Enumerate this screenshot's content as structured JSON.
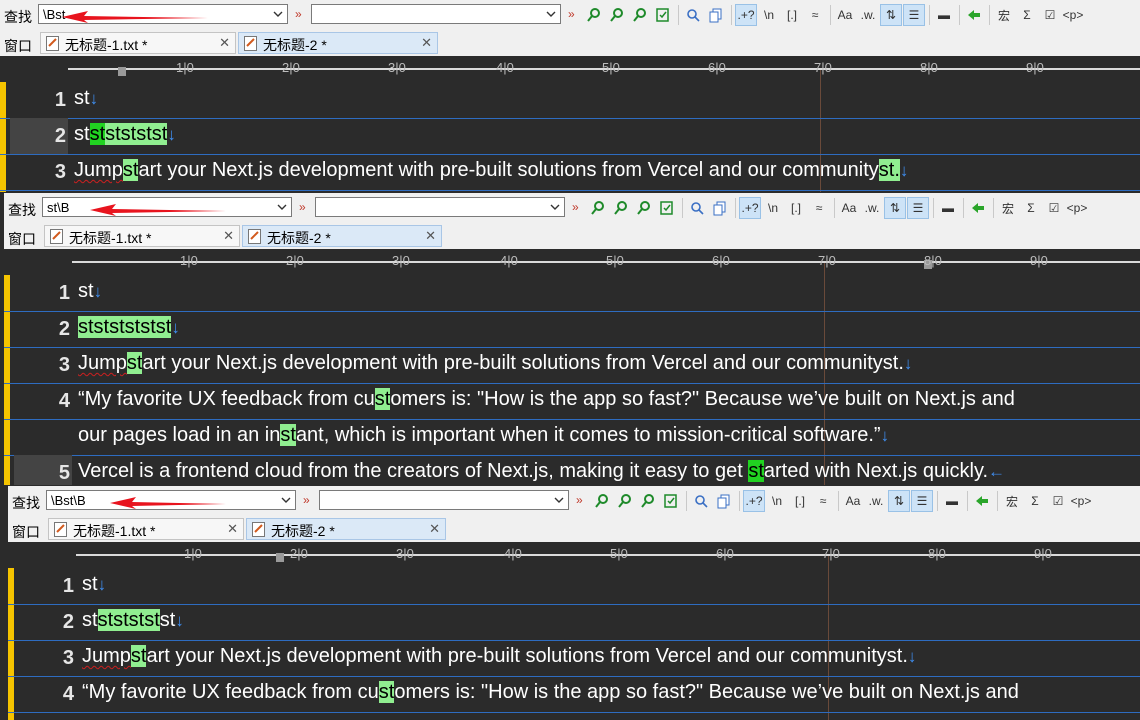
{
  "labels": {
    "find": "查找",
    "window": "窗口"
  },
  "panels": [
    {
      "find_value": "\\Bst"
    },
    {
      "find_value": "st\\B"
    },
    {
      "find_value": "\\Bst\\B"
    }
  ],
  "tabs": [
    {
      "label": "无标题-1.txt *",
      "close": "✕"
    },
    {
      "label": "无标题-2 *",
      "close": "✕"
    }
  ],
  "toolbar": {
    "regex_label": ".+?",
    "newline_label": "\\n",
    "brackets_label": "[.]",
    "case_label": "Aa",
    "word_label": ".w.",
    "macro_label": "宏",
    "sigma_label": "Σ",
    "para_label": "<p>"
  },
  "ruler": {
    "numbers": [
      "1|0",
      "2|0",
      "3|0",
      "4|0",
      "5|0",
      "6|0",
      "7|0",
      "8|0",
      "9|0"
    ]
  },
  "editor_lines": {
    "line1": "st",
    "line2": "stststststst",
    "line3_pre": "Jump",
    "line3_hl": "st",
    "line3_a": "art your Next.js development with pre-built solutions from Vercel and our community",
    "line3_b": "st.",
    "line4_pre": "“My favorite UX feedback from cu",
    "line4_hl": "st",
    "line4_post": "omers is: \"How is the app so fast?\" Because we’ve built on Next.js and",
    "line4b_pre": "our pages load in an in",
    "line4b_hl": "st",
    "line4b_post": "ant, which is important when it comes to mission-critical software.”",
    "line5_pre": "Vercel is a frontend cloud from the creators of Next.js, making it easy to get ",
    "line5_hl": "st",
    "line5_post": "arted with Next.js quickly."
  },
  "line_numbers": [
    "1",
    "2",
    "3",
    "4",
    "5"
  ],
  "colors": {
    "match": "#90ee90",
    "current_match": "#21d321",
    "editor_bg": "#2b2b2b",
    "line_rule": "#2e6cc0",
    "eol": "#3f8ef0",
    "arrow": "#e8141e"
  }
}
